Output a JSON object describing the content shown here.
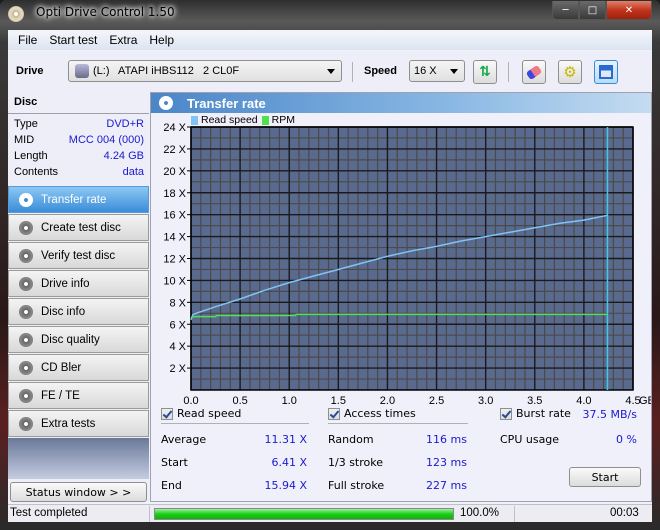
{
  "window": {
    "title": "Opti Drive Control 1.50"
  },
  "menu": [
    "File",
    "Start test",
    "Extra",
    "Help"
  ],
  "toolbar": {
    "drive_label": "Drive",
    "drive_value": "(L:)   ATAPI iHBS112   2 CL0F",
    "speed_label": "Speed",
    "speed_value": "16 X",
    "icons": [
      "refresh-icon",
      "eraser-icon",
      "settings-icon",
      "save-icon"
    ]
  },
  "disc": {
    "header": "Disc",
    "rows": [
      {
        "label": "Type",
        "value": "DVD+R"
      },
      {
        "label": "MID",
        "value": "MCC 004 (000)"
      },
      {
        "label": "Length",
        "value": "4.24 GB"
      },
      {
        "label": "Contents",
        "value": "data"
      }
    ]
  },
  "nav": [
    {
      "label": "Transfer rate",
      "active": true
    },
    {
      "label": "Create test disc"
    },
    {
      "label": "Verify test disc"
    },
    {
      "label": "Drive info"
    },
    {
      "label": "Disc info"
    },
    {
      "label": "Disc quality"
    },
    {
      "label": "CD Bler"
    },
    {
      "label": "FE / TE"
    },
    {
      "label": "Extra tests"
    }
  ],
  "status_window_button": "Status window > >",
  "panel": {
    "title": "Transfer rate"
  },
  "chart_data": {
    "type": "line",
    "title": "Transfer rate",
    "xlabel": "GB",
    "ylabel": "X",
    "xlim": [
      0,
      4.5
    ],
    "ylim": [
      0,
      24
    ],
    "x_ticks": [
      "0.0",
      "0.5",
      "1.0",
      "1.5",
      "2.0",
      "2.5",
      "3.0",
      "3.5",
      "4.0",
      "4.5"
    ],
    "x_unit": "GB",
    "y_ticks": [
      "2 X",
      "4 X",
      "6 X",
      "8 X",
      "10 X",
      "12 X",
      "14 X",
      "16 X",
      "18 X",
      "20 X",
      "22 X",
      "24 X"
    ],
    "grid": true,
    "legend": {
      "placement": "top-left",
      "entries": [
        "Read speed",
        "RPM"
      ]
    },
    "series": [
      {
        "name": "Read speed",
        "color": "#7ec4f4",
        "x": [
          0,
          0.02,
          0.25,
          0.5,
          0.75,
          1.0,
          1.25,
          1.5,
          1.75,
          2.0,
          2.25,
          2.5,
          2.75,
          3.0,
          3.25,
          3.5,
          3.75,
          4.0,
          4.24
        ],
        "y": [
          6.41,
          6.9,
          7.6,
          8.3,
          9.1,
          9.8,
          10.4,
          11.0,
          11.6,
          12.2,
          12.7,
          13.1,
          13.6,
          14.0,
          14.4,
          14.8,
          15.2,
          15.5,
          15.94
        ]
      },
      {
        "name": "RPM",
        "color": "#50e050",
        "x": [
          0,
          0.03,
          0.25,
          0.26,
          1.06,
          1.07,
          4.24
        ],
        "y": [
          6.6,
          6.7,
          6.7,
          6.8,
          6.8,
          6.9,
          6.9
        ]
      }
    ],
    "marker_line": {
      "x": 4.24,
      "color": "#40c8e8"
    }
  },
  "results": {
    "read_speed": {
      "label": "Read speed",
      "checked": true,
      "rows": [
        {
          "label": "Average",
          "value": "11.31 X"
        },
        {
          "label": "Start",
          "value": "6.41 X"
        },
        {
          "label": "End",
          "value": "15.94 X"
        }
      ]
    },
    "access_times": {
      "label": "Access times",
      "checked": true,
      "rows": [
        {
          "label": "Random",
          "value": "116 ms"
        },
        {
          "label": "1/3 stroke",
          "value": "123 ms"
        },
        {
          "label": "Full stroke",
          "value": "227 ms"
        }
      ]
    },
    "burst_rate": {
      "label": "Burst rate",
      "checked": true,
      "value": "37.5 MB/s"
    },
    "cpu_usage": {
      "label": "CPU usage",
      "value": "0 %"
    },
    "start_button": "Start"
  },
  "statusbar": {
    "text": "Test completed",
    "progress_percent": 100,
    "progress_label": "100.0%",
    "elapsed": "00:03"
  }
}
